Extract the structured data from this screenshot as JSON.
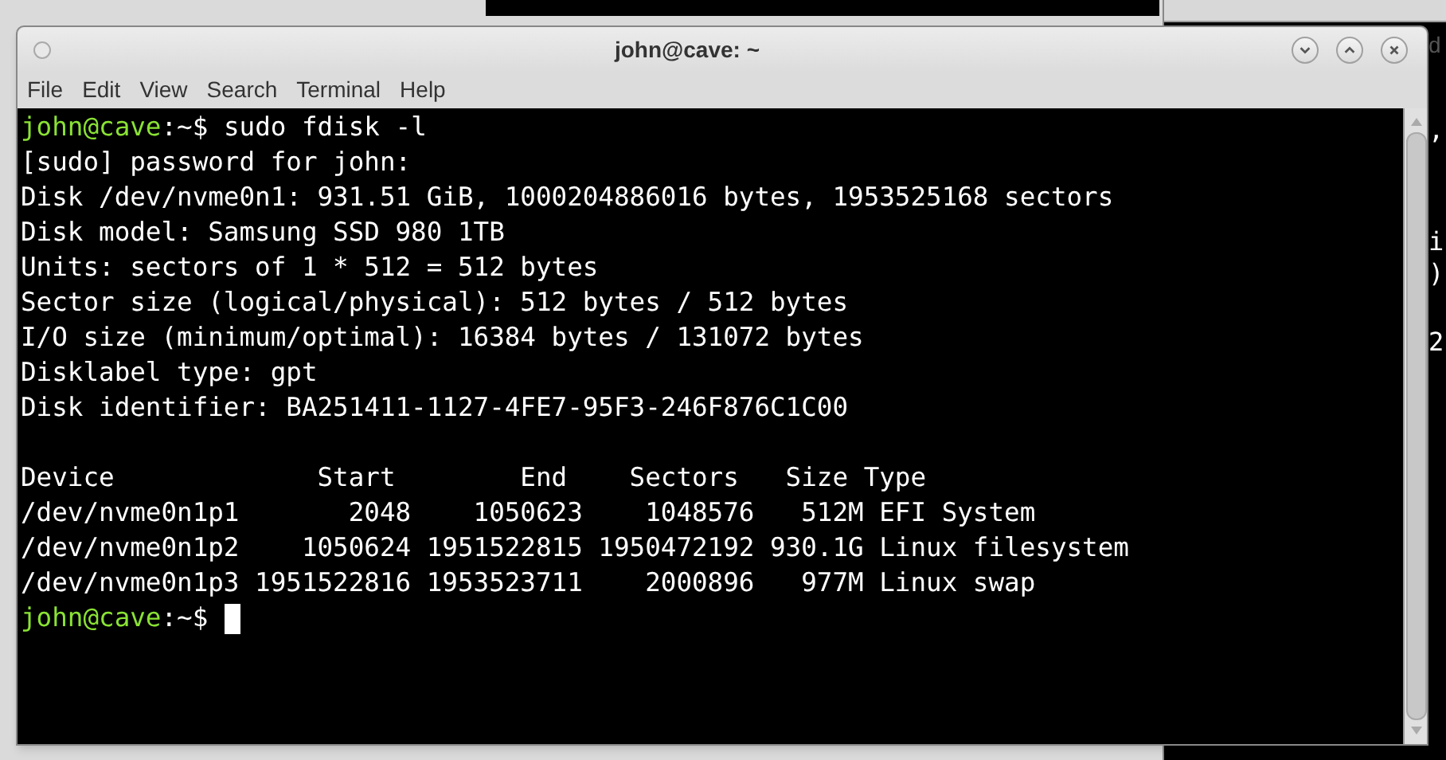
{
  "background": {
    "title_fragment": "d",
    "edge_fragments": [
      ",",
      "i",
      ")",
      "2"
    ]
  },
  "window": {
    "title": "john@cave: ~"
  },
  "menu": [
    "File",
    "Edit",
    "View",
    "Search",
    "Terminal",
    "Help"
  ],
  "terminal": {
    "lines": [
      {
        "kind": "prompt",
        "user": "john@cave",
        "path": ":~$",
        "command": " sudo fdisk -l",
        "cursor": false
      },
      {
        "kind": "output",
        "text": "[sudo] password for john:"
      },
      {
        "kind": "output",
        "text": "Disk /dev/nvme0n1: 931.51 GiB, 1000204886016 bytes, 1953525168 sectors"
      },
      {
        "kind": "output",
        "text": "Disk model: Samsung SSD 980 1TB"
      },
      {
        "kind": "output",
        "text": "Units: sectors of 1 * 512 = 512 bytes"
      },
      {
        "kind": "output",
        "text": "Sector size (logical/physical): 512 bytes / 512 bytes"
      },
      {
        "kind": "output",
        "text": "I/O size (minimum/optimal): 16384 bytes / 131072 bytes"
      },
      {
        "kind": "output",
        "text": "Disklabel type: gpt"
      },
      {
        "kind": "output",
        "text": "Disk identifier: BA251411-1127-4FE7-95F3-246F876C1C00"
      },
      {
        "kind": "blank"
      },
      {
        "kind": "output",
        "text": "Device             Start        End    Sectors   Size Type"
      },
      {
        "kind": "output",
        "text": "/dev/nvme0n1p1       2048    1050623    1048576   512M EFI System"
      },
      {
        "kind": "output",
        "text": "/dev/nvme0n1p2    1050624 1951522815 1950472192 930.1G Linux filesystem"
      },
      {
        "kind": "output",
        "text": "/dev/nvme0n1p3 1951522816 1953523711    2000896   977M Linux swap"
      },
      {
        "kind": "prompt",
        "user": "john@cave",
        "path": ":~$",
        "cursor": true
      }
    ]
  }
}
